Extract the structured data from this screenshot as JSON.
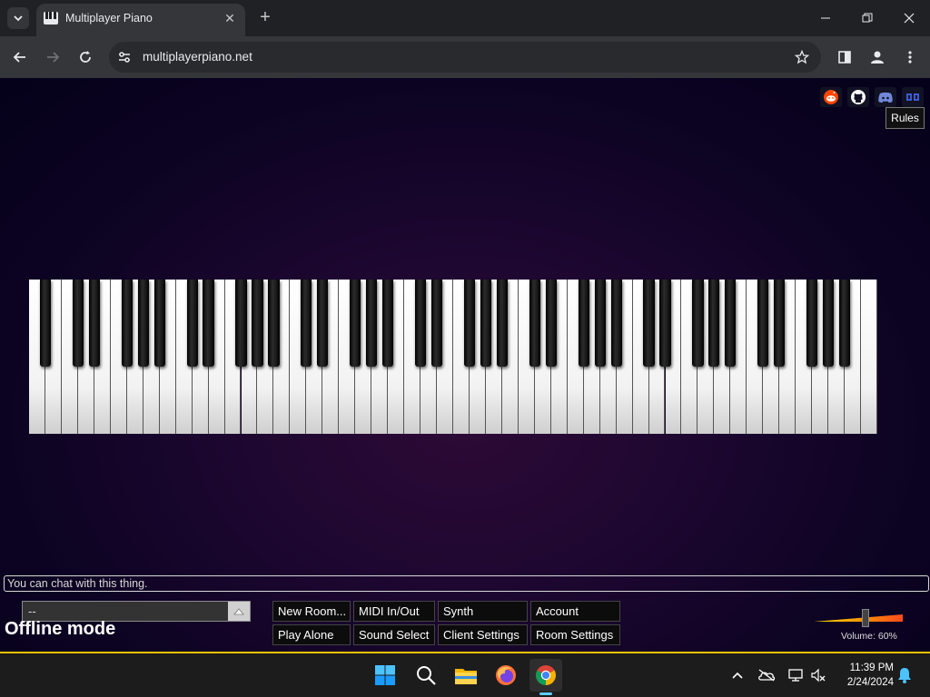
{
  "browser": {
    "tab_title": "Multiplayer Piano",
    "url": "multiplayerpiano.net"
  },
  "page": {
    "social_icons": [
      "reddit-icon",
      "github-icon",
      "discord-icon",
      "mpp-icon"
    ],
    "rules_tooltip": "Rules",
    "piano": {
      "white_keys": 52,
      "black_keys": 36
    },
    "chat_placeholder": "You can chat with this thing.",
    "room_select_value": "--",
    "status": "Offline mode",
    "buttons": {
      "new_room": "New Room...",
      "play_alone": "Play Alone",
      "midi": "MIDI In/Out",
      "sound_select": "Sound Select",
      "synth": "Synth",
      "client_settings": "Client Settings",
      "account": "Account",
      "room_settings": "Room Settings"
    },
    "volume": {
      "label": "Volume: 60%",
      "value": 0.6
    }
  },
  "taskbar": {
    "apps": [
      "windows-start-icon",
      "search-icon",
      "file-explorer-icon",
      "firefox-icon",
      "chrome-icon"
    ],
    "time": "11:39 PM",
    "date": "2/24/2024"
  },
  "colors": {
    "accent_line": "#f2c200",
    "page_bg": "#1d0730"
  }
}
